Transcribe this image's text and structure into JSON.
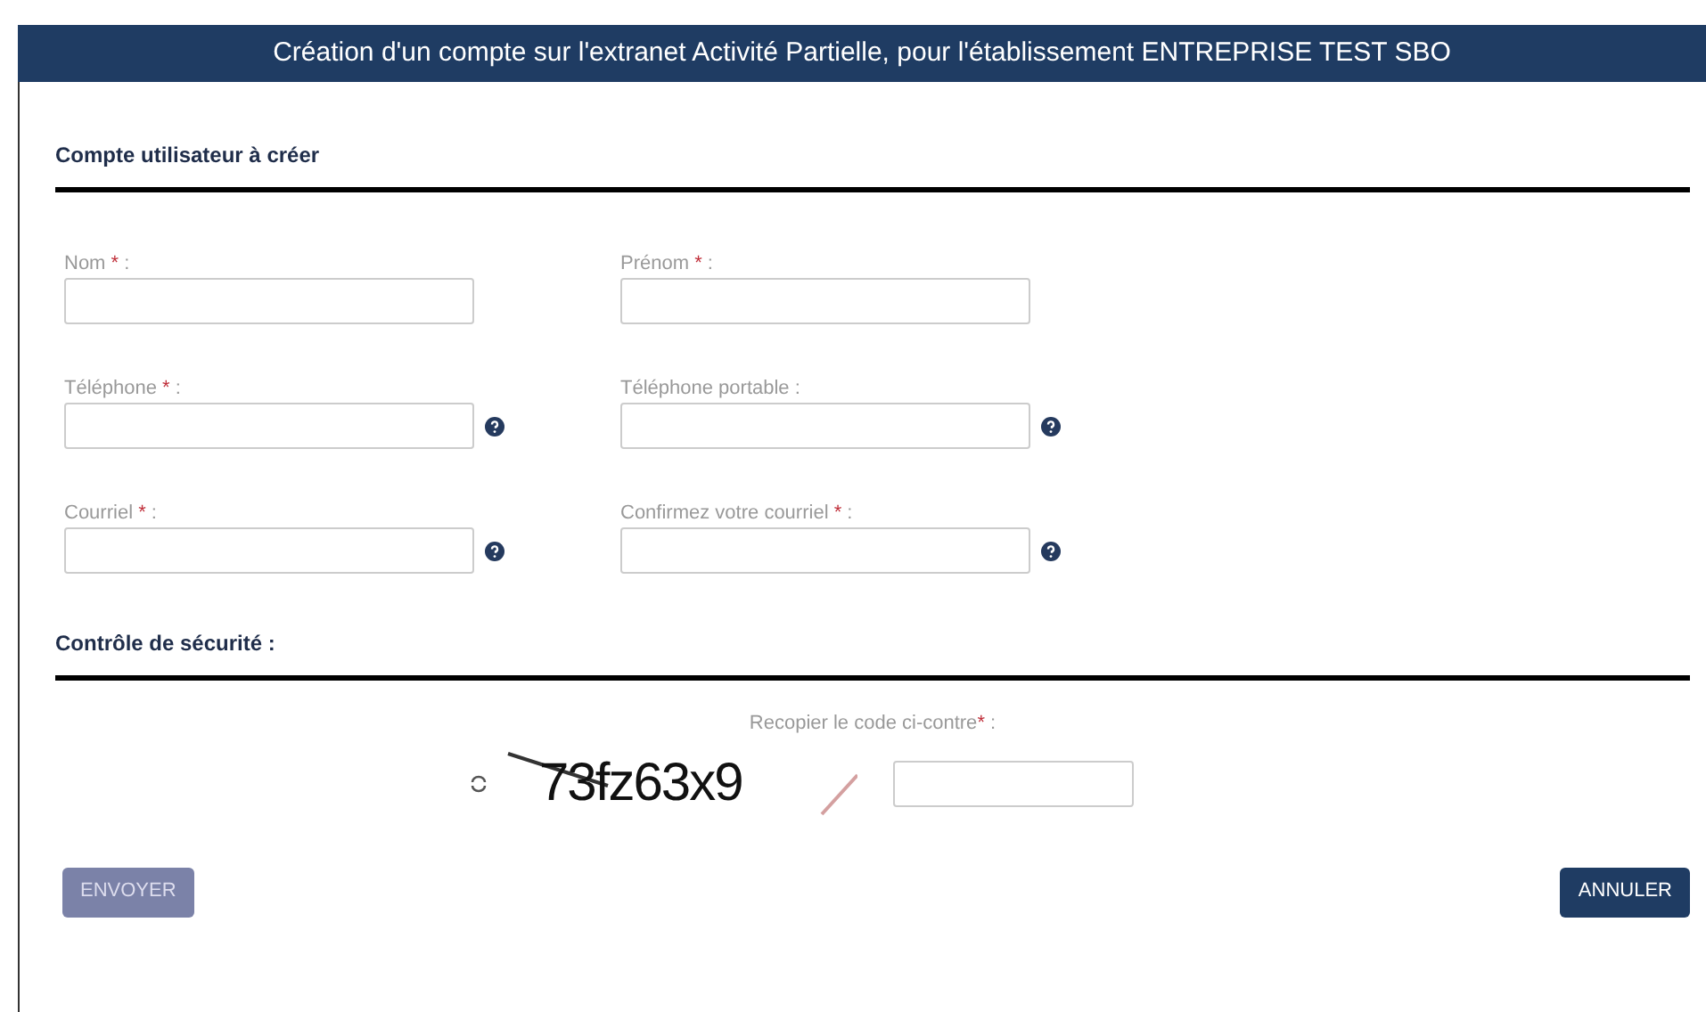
{
  "header": {
    "title": "Création d'un compte sur l'extranet Activité Partielle, pour l'établissement ENTREPRISE TEST SBO"
  },
  "sections": [
    {
      "title": "Compte utilisateur à créer",
      "fields": [
        {
          "label": "Nom",
          "required_mark": "*",
          "suffix": ":",
          "help": false
        },
        {
          "label": "Prénom",
          "required_mark": "*",
          "suffix": ":",
          "help": false
        },
        {
          "label": "Téléphone",
          "required_mark": "*",
          "suffix": ":",
          "help": true
        },
        {
          "label": "Téléphone portable",
          "suffix": ":",
          "help": true
        },
        {
          "label": "Courriel",
          "required_mark": "*",
          "suffix": ":",
          "help": true
        },
        {
          "label": "Confirmez votre courriel",
          "required_mark": "*",
          "suffix": ":",
          "help": true
        }
      ]
    },
    {
      "title": "Contrôle de sécurité :"
    }
  ],
  "captcha": {
    "label": "Recopier le code ci-contre",
    "required_mark": "*",
    "suffix": ":",
    "code": "73fz63x9"
  },
  "buttons": [
    {
      "label": "ENVOYER",
      "disabled": true
    },
    {
      "label": "ANNULER",
      "disabled": false
    }
  ]
}
